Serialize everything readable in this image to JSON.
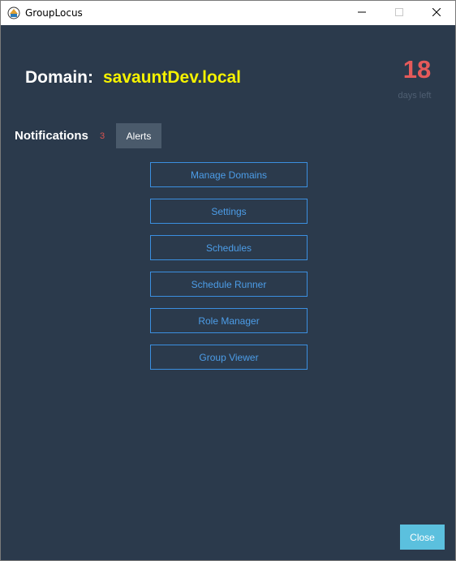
{
  "window": {
    "title": "GroupLocus",
    "icon": "grouplocus-logo-icon"
  },
  "header": {
    "domain_label": "Domain:",
    "domain_value": "savauntDev.local",
    "days_left_number": "18",
    "days_left_label": "days left"
  },
  "notifications": {
    "label": "Notifications",
    "count": "3",
    "alerts_label": "Alerts"
  },
  "menu": {
    "items": [
      {
        "label": "Manage Domains"
      },
      {
        "label": "Settings"
      },
      {
        "label": "Schedules"
      },
      {
        "label": "Schedule Runner"
      },
      {
        "label": "Role Manager"
      },
      {
        "label": "Group Viewer"
      }
    ]
  },
  "footer": {
    "close_label": "Close"
  },
  "colors": {
    "background": "#2b3a4c",
    "domain_value": "#f5f200",
    "days_number": "#e55a5a",
    "menu_border": "#3b8fe0",
    "close_button": "#5bc0de"
  }
}
